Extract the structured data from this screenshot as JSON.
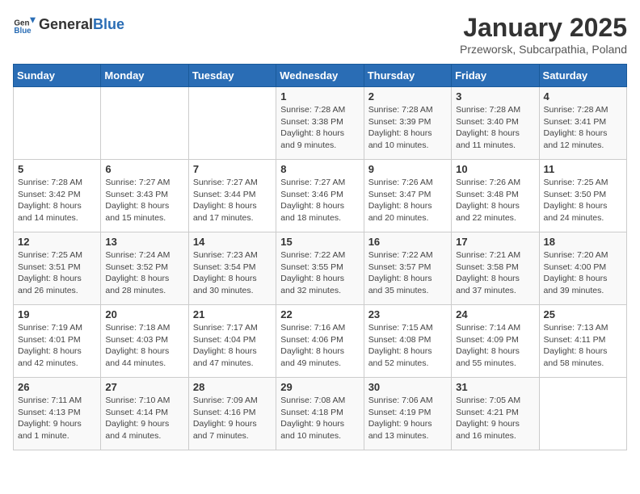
{
  "header": {
    "logo_general": "General",
    "logo_blue": "Blue",
    "month_title": "January 2025",
    "subtitle": "Przeworsk, Subcarpathia, Poland"
  },
  "weekdays": [
    "Sunday",
    "Monday",
    "Tuesday",
    "Wednesday",
    "Thursday",
    "Friday",
    "Saturday"
  ],
  "weeks": [
    [
      {
        "day": "",
        "info": ""
      },
      {
        "day": "",
        "info": ""
      },
      {
        "day": "",
        "info": ""
      },
      {
        "day": "1",
        "info": "Sunrise: 7:28 AM\nSunset: 3:38 PM\nDaylight: 8 hours\nand 9 minutes."
      },
      {
        "day": "2",
        "info": "Sunrise: 7:28 AM\nSunset: 3:39 PM\nDaylight: 8 hours\nand 10 minutes."
      },
      {
        "day": "3",
        "info": "Sunrise: 7:28 AM\nSunset: 3:40 PM\nDaylight: 8 hours\nand 11 minutes."
      },
      {
        "day": "4",
        "info": "Sunrise: 7:28 AM\nSunset: 3:41 PM\nDaylight: 8 hours\nand 12 minutes."
      }
    ],
    [
      {
        "day": "5",
        "info": "Sunrise: 7:28 AM\nSunset: 3:42 PM\nDaylight: 8 hours\nand 14 minutes."
      },
      {
        "day": "6",
        "info": "Sunrise: 7:27 AM\nSunset: 3:43 PM\nDaylight: 8 hours\nand 15 minutes."
      },
      {
        "day": "7",
        "info": "Sunrise: 7:27 AM\nSunset: 3:44 PM\nDaylight: 8 hours\nand 17 minutes."
      },
      {
        "day": "8",
        "info": "Sunrise: 7:27 AM\nSunset: 3:46 PM\nDaylight: 8 hours\nand 18 minutes."
      },
      {
        "day": "9",
        "info": "Sunrise: 7:26 AM\nSunset: 3:47 PM\nDaylight: 8 hours\nand 20 minutes."
      },
      {
        "day": "10",
        "info": "Sunrise: 7:26 AM\nSunset: 3:48 PM\nDaylight: 8 hours\nand 22 minutes."
      },
      {
        "day": "11",
        "info": "Sunrise: 7:25 AM\nSunset: 3:50 PM\nDaylight: 8 hours\nand 24 minutes."
      }
    ],
    [
      {
        "day": "12",
        "info": "Sunrise: 7:25 AM\nSunset: 3:51 PM\nDaylight: 8 hours\nand 26 minutes."
      },
      {
        "day": "13",
        "info": "Sunrise: 7:24 AM\nSunset: 3:52 PM\nDaylight: 8 hours\nand 28 minutes."
      },
      {
        "day": "14",
        "info": "Sunrise: 7:23 AM\nSunset: 3:54 PM\nDaylight: 8 hours\nand 30 minutes."
      },
      {
        "day": "15",
        "info": "Sunrise: 7:22 AM\nSunset: 3:55 PM\nDaylight: 8 hours\nand 32 minutes."
      },
      {
        "day": "16",
        "info": "Sunrise: 7:22 AM\nSunset: 3:57 PM\nDaylight: 8 hours\nand 35 minutes."
      },
      {
        "day": "17",
        "info": "Sunrise: 7:21 AM\nSunset: 3:58 PM\nDaylight: 8 hours\nand 37 minutes."
      },
      {
        "day": "18",
        "info": "Sunrise: 7:20 AM\nSunset: 4:00 PM\nDaylight: 8 hours\nand 39 minutes."
      }
    ],
    [
      {
        "day": "19",
        "info": "Sunrise: 7:19 AM\nSunset: 4:01 PM\nDaylight: 8 hours\nand 42 minutes."
      },
      {
        "day": "20",
        "info": "Sunrise: 7:18 AM\nSunset: 4:03 PM\nDaylight: 8 hours\nand 44 minutes."
      },
      {
        "day": "21",
        "info": "Sunrise: 7:17 AM\nSunset: 4:04 PM\nDaylight: 8 hours\nand 47 minutes."
      },
      {
        "day": "22",
        "info": "Sunrise: 7:16 AM\nSunset: 4:06 PM\nDaylight: 8 hours\nand 49 minutes."
      },
      {
        "day": "23",
        "info": "Sunrise: 7:15 AM\nSunset: 4:08 PM\nDaylight: 8 hours\nand 52 minutes."
      },
      {
        "day": "24",
        "info": "Sunrise: 7:14 AM\nSunset: 4:09 PM\nDaylight: 8 hours\nand 55 minutes."
      },
      {
        "day": "25",
        "info": "Sunrise: 7:13 AM\nSunset: 4:11 PM\nDaylight: 8 hours\nand 58 minutes."
      }
    ],
    [
      {
        "day": "26",
        "info": "Sunrise: 7:11 AM\nSunset: 4:13 PM\nDaylight: 9 hours\nand 1 minute."
      },
      {
        "day": "27",
        "info": "Sunrise: 7:10 AM\nSunset: 4:14 PM\nDaylight: 9 hours\nand 4 minutes."
      },
      {
        "day": "28",
        "info": "Sunrise: 7:09 AM\nSunset: 4:16 PM\nDaylight: 9 hours\nand 7 minutes."
      },
      {
        "day": "29",
        "info": "Sunrise: 7:08 AM\nSunset: 4:18 PM\nDaylight: 9 hours\nand 10 minutes."
      },
      {
        "day": "30",
        "info": "Sunrise: 7:06 AM\nSunset: 4:19 PM\nDaylight: 9 hours\nand 13 minutes."
      },
      {
        "day": "31",
        "info": "Sunrise: 7:05 AM\nSunset: 4:21 PM\nDaylight: 9 hours\nand 16 minutes."
      },
      {
        "day": "",
        "info": ""
      }
    ]
  ]
}
